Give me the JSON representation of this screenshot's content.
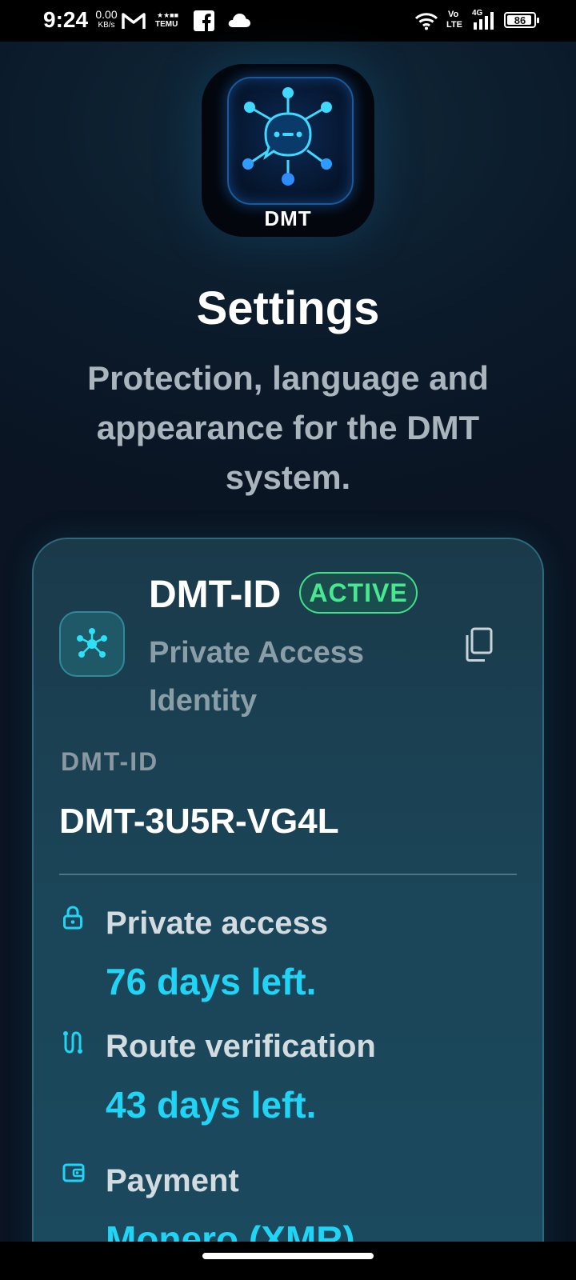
{
  "status_bar": {
    "time": "9:24",
    "net_speed_value": "0.00",
    "net_speed_unit": "KB/s",
    "temu_label": "TEMU",
    "volte_top": "Vo",
    "volte_bottom": "LTE",
    "network_type": "4G",
    "battery_level": "86",
    "icons": [
      "gmail-icon",
      "temu-icon",
      "facebook-icon",
      "cloud-icon",
      "wifi-icon",
      "signal-icon",
      "battery-icon"
    ]
  },
  "app_icon": {
    "label": "DMT"
  },
  "header": {
    "title": "Settings",
    "subtitle": "Protection, language and appearance for the DMT system."
  },
  "identity_card": {
    "title": "DMT-ID",
    "status_badge": "ACTIVE",
    "subtitle": "Private Access Identity",
    "field_label": "DMT-ID",
    "field_value": "DMT-3U5R-VG4L",
    "rows": [
      {
        "icon": "lock-icon",
        "label": "Private access",
        "value": "76 days left."
      },
      {
        "icon": "route-icon",
        "label": "Route verification",
        "value": "43 days left."
      },
      {
        "icon": "wallet-icon",
        "label": "Payment",
        "value": "Monero (XMR)"
      }
    ]
  },
  "colors": {
    "accent": "#1fd4f4",
    "active_green": "#48e890",
    "background": "#0a1524",
    "card": "#1b4558"
  }
}
